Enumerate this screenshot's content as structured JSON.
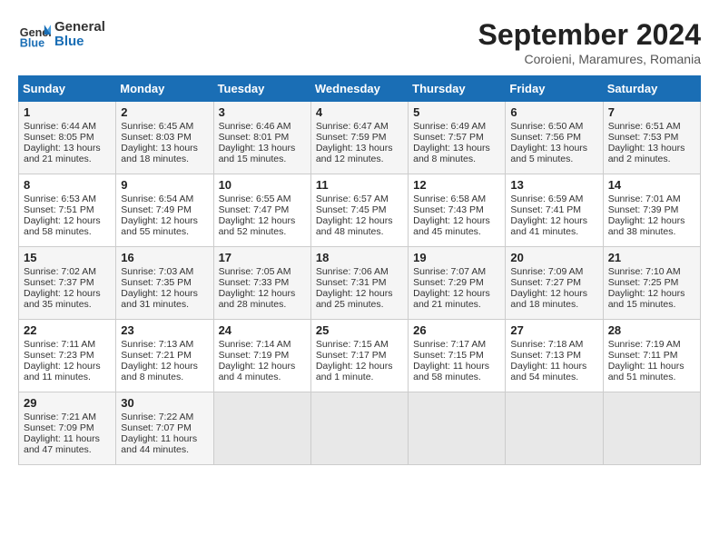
{
  "header": {
    "logo": "GeneralBlue",
    "title": "September 2024",
    "subtitle": "Coroieni, Maramures, Romania"
  },
  "weekdays": [
    "Sunday",
    "Monday",
    "Tuesday",
    "Wednesday",
    "Thursday",
    "Friday",
    "Saturday"
  ],
  "weeks": [
    [
      {
        "day": "1",
        "lines": [
          "Sunrise: 6:44 AM",
          "Sunset: 8:05 PM",
          "Daylight: 13 hours",
          "and 21 minutes."
        ]
      },
      {
        "day": "2",
        "lines": [
          "Sunrise: 6:45 AM",
          "Sunset: 8:03 PM",
          "Daylight: 13 hours",
          "and 18 minutes."
        ]
      },
      {
        "day": "3",
        "lines": [
          "Sunrise: 6:46 AM",
          "Sunset: 8:01 PM",
          "Daylight: 13 hours",
          "and 15 minutes."
        ]
      },
      {
        "day": "4",
        "lines": [
          "Sunrise: 6:47 AM",
          "Sunset: 7:59 PM",
          "Daylight: 13 hours",
          "and 12 minutes."
        ]
      },
      {
        "day": "5",
        "lines": [
          "Sunrise: 6:49 AM",
          "Sunset: 7:57 PM",
          "Daylight: 13 hours",
          "and 8 minutes."
        ]
      },
      {
        "day": "6",
        "lines": [
          "Sunrise: 6:50 AM",
          "Sunset: 7:56 PM",
          "Daylight: 13 hours",
          "and 5 minutes."
        ]
      },
      {
        "day": "7",
        "lines": [
          "Sunrise: 6:51 AM",
          "Sunset: 7:53 PM",
          "Daylight: 13 hours",
          "and 2 minutes."
        ]
      }
    ],
    [
      {
        "day": "8",
        "lines": [
          "Sunrise: 6:53 AM",
          "Sunset: 7:51 PM",
          "Daylight: 12 hours",
          "and 58 minutes."
        ]
      },
      {
        "day": "9",
        "lines": [
          "Sunrise: 6:54 AM",
          "Sunset: 7:49 PM",
          "Daylight: 12 hours",
          "and 55 minutes."
        ]
      },
      {
        "day": "10",
        "lines": [
          "Sunrise: 6:55 AM",
          "Sunset: 7:47 PM",
          "Daylight: 12 hours",
          "and 52 minutes."
        ]
      },
      {
        "day": "11",
        "lines": [
          "Sunrise: 6:57 AM",
          "Sunset: 7:45 PM",
          "Daylight: 12 hours",
          "and 48 minutes."
        ]
      },
      {
        "day": "12",
        "lines": [
          "Sunrise: 6:58 AM",
          "Sunset: 7:43 PM",
          "Daylight: 12 hours",
          "and 45 minutes."
        ]
      },
      {
        "day": "13",
        "lines": [
          "Sunrise: 6:59 AM",
          "Sunset: 7:41 PM",
          "Daylight: 12 hours",
          "and 41 minutes."
        ]
      },
      {
        "day": "14",
        "lines": [
          "Sunrise: 7:01 AM",
          "Sunset: 7:39 PM",
          "Daylight: 12 hours",
          "and 38 minutes."
        ]
      }
    ],
    [
      {
        "day": "15",
        "lines": [
          "Sunrise: 7:02 AM",
          "Sunset: 7:37 PM",
          "Daylight: 12 hours",
          "and 35 minutes."
        ]
      },
      {
        "day": "16",
        "lines": [
          "Sunrise: 7:03 AM",
          "Sunset: 7:35 PM",
          "Daylight: 12 hours",
          "and 31 minutes."
        ]
      },
      {
        "day": "17",
        "lines": [
          "Sunrise: 7:05 AM",
          "Sunset: 7:33 PM",
          "Daylight: 12 hours",
          "and 28 minutes."
        ]
      },
      {
        "day": "18",
        "lines": [
          "Sunrise: 7:06 AM",
          "Sunset: 7:31 PM",
          "Daylight: 12 hours",
          "and 25 minutes."
        ]
      },
      {
        "day": "19",
        "lines": [
          "Sunrise: 7:07 AM",
          "Sunset: 7:29 PM",
          "Daylight: 12 hours",
          "and 21 minutes."
        ]
      },
      {
        "day": "20",
        "lines": [
          "Sunrise: 7:09 AM",
          "Sunset: 7:27 PM",
          "Daylight: 12 hours",
          "and 18 minutes."
        ]
      },
      {
        "day": "21",
        "lines": [
          "Sunrise: 7:10 AM",
          "Sunset: 7:25 PM",
          "Daylight: 12 hours",
          "and 15 minutes."
        ]
      }
    ],
    [
      {
        "day": "22",
        "lines": [
          "Sunrise: 7:11 AM",
          "Sunset: 7:23 PM",
          "Daylight: 12 hours",
          "and 11 minutes."
        ]
      },
      {
        "day": "23",
        "lines": [
          "Sunrise: 7:13 AM",
          "Sunset: 7:21 PM",
          "Daylight: 12 hours",
          "and 8 minutes."
        ]
      },
      {
        "day": "24",
        "lines": [
          "Sunrise: 7:14 AM",
          "Sunset: 7:19 PM",
          "Daylight: 12 hours",
          "and 4 minutes."
        ]
      },
      {
        "day": "25",
        "lines": [
          "Sunrise: 7:15 AM",
          "Sunset: 7:17 PM",
          "Daylight: 12 hours",
          "and 1 minute."
        ]
      },
      {
        "day": "26",
        "lines": [
          "Sunrise: 7:17 AM",
          "Sunset: 7:15 PM",
          "Daylight: 11 hours",
          "and 58 minutes."
        ]
      },
      {
        "day": "27",
        "lines": [
          "Sunrise: 7:18 AM",
          "Sunset: 7:13 PM",
          "Daylight: 11 hours",
          "and 54 minutes."
        ]
      },
      {
        "day": "28",
        "lines": [
          "Sunrise: 7:19 AM",
          "Sunset: 7:11 PM",
          "Daylight: 11 hours",
          "and 51 minutes."
        ]
      }
    ],
    [
      {
        "day": "29",
        "lines": [
          "Sunrise: 7:21 AM",
          "Sunset: 7:09 PM",
          "Daylight: 11 hours",
          "and 47 minutes."
        ]
      },
      {
        "day": "30",
        "lines": [
          "Sunrise: 7:22 AM",
          "Sunset: 7:07 PM",
          "Daylight: 11 hours",
          "and 44 minutes."
        ]
      },
      {
        "day": "",
        "lines": []
      },
      {
        "day": "",
        "lines": []
      },
      {
        "day": "",
        "lines": []
      },
      {
        "day": "",
        "lines": []
      },
      {
        "day": "",
        "lines": []
      }
    ]
  ]
}
